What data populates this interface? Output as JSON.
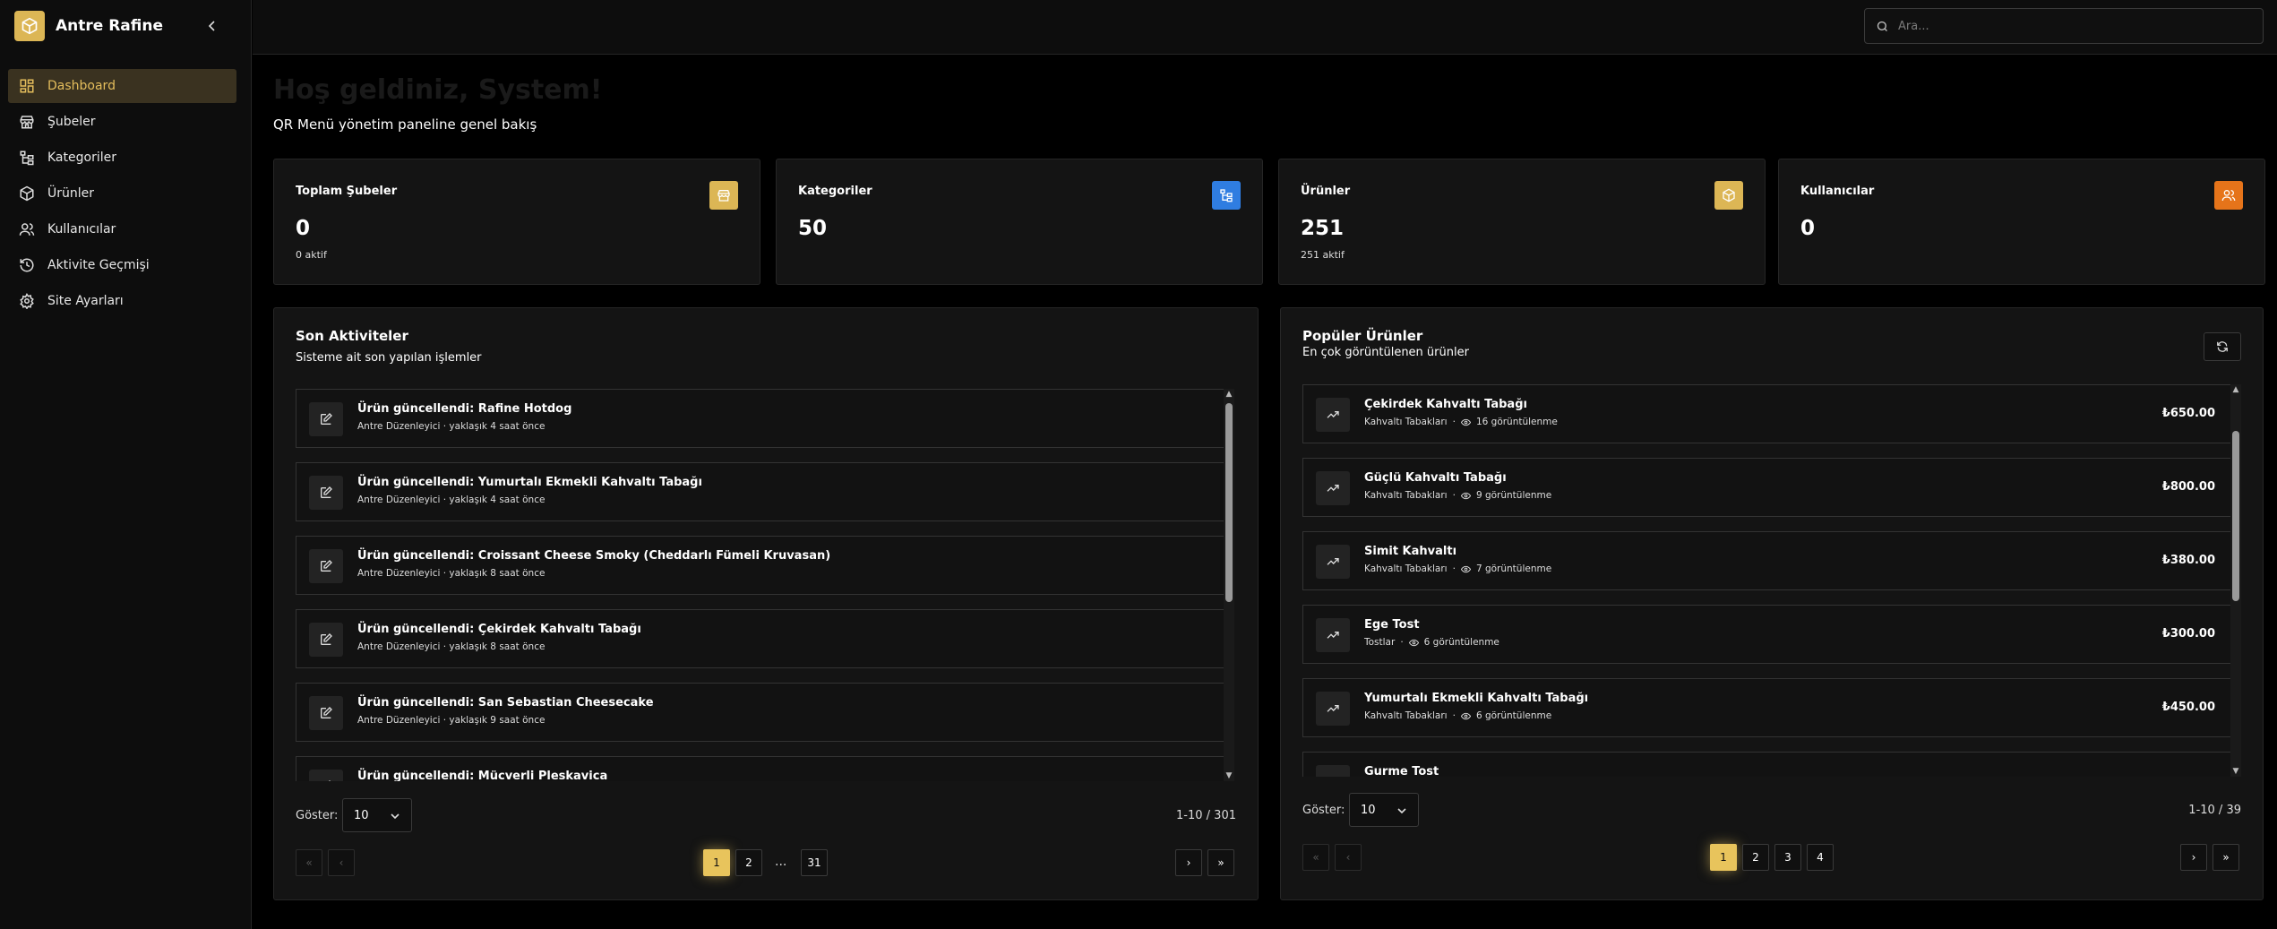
{
  "brand": {
    "name": "Antre Rafine"
  },
  "sidebar": {
    "items": [
      {
        "label": "Dashboard",
        "icon": "dashboard-icon",
        "active": true
      },
      {
        "label": "Şubeler",
        "icon": "store-icon"
      },
      {
        "label": "Kategoriler",
        "icon": "category-icon"
      },
      {
        "label": "Ürünler",
        "icon": "box-icon"
      },
      {
        "label": "Kullanıcılar",
        "icon": "users-icon"
      },
      {
        "label": "Aktivite Geçmişi",
        "icon": "history-icon"
      },
      {
        "label": "Site Ayarları",
        "icon": "gear-icon"
      }
    ]
  },
  "search": {
    "placeholder": "Ara..."
  },
  "welcome": {
    "title": "Hoş geldiniz, System!",
    "subtitle": "QR Menü yönetim paneline genel bakış"
  },
  "stats": [
    {
      "title": "Toplam Şubeler",
      "value": "0",
      "sub": "0 aktif",
      "color": "#dcb655",
      "icon": "store-icon"
    },
    {
      "title": "Kategoriler",
      "value": "50",
      "sub": "",
      "color": "#2f7de1",
      "icon": "category-icon"
    },
    {
      "title": "Ürünler",
      "value": "251",
      "sub": "251 aktif",
      "color": "#dcb655",
      "icon": "box-icon"
    },
    {
      "title": "Kullanıcılar",
      "value": "0",
      "sub": "",
      "color": "#e6741a",
      "icon": "users-icon"
    }
  ],
  "activities": {
    "title": "Son Aktiviteler",
    "subtitle": "Sisteme ait son yapılan işlemler",
    "items": [
      {
        "title": "Ürün güncellendi: Rafine Hotdog",
        "meta": "Antre Düzenleyici · yaklaşık 4 saat önce"
      },
      {
        "title": "Ürün güncellendi: Yumurtalı Ekmekli Kahvaltı Tabağı",
        "meta": "Antre Düzenleyici · yaklaşık 4 saat önce"
      },
      {
        "title": "Ürün güncellendi: Croissant Cheese Smoky (Cheddarlı Fümeli Kruvasan)",
        "meta": "Antre Düzenleyici · yaklaşık 8 saat önce"
      },
      {
        "title": "Ürün güncellendi: Çekirdek Kahvaltı Tabağı",
        "meta": "Antre Düzenleyici · yaklaşık 8 saat önce"
      },
      {
        "title": "Ürün güncellendi: San Sebastian Cheesecake",
        "meta": "Antre Düzenleyici · yaklaşık 9 saat önce"
      },
      {
        "title": "Ürün güncellendi: Mücverli Pleskavica",
        "meta": ""
      }
    ],
    "show_label": "Göster:",
    "page_size": "10",
    "range": "1-10 / 301",
    "pages": [
      "1",
      "2",
      "...",
      "31"
    ]
  },
  "popular": {
    "title": "Popüler Ürünler",
    "subtitle": "En çok görüntülenen ürünler",
    "items": [
      {
        "name": "Çekirdek Kahvaltı Tabağı",
        "category": "Kahvaltı Tabakları",
        "views": "16 görüntülenme",
        "price": "₺650.00"
      },
      {
        "name": "Güçlü Kahvaltı Tabağı",
        "category": "Kahvaltı Tabakları",
        "views": "9 görüntülenme",
        "price": "₺800.00"
      },
      {
        "name": "Simit Kahvaltı",
        "category": "Kahvaltı Tabakları",
        "views": "7 görüntülenme",
        "price": "₺380.00"
      },
      {
        "name": "Ege Tost",
        "category": "Tostlar",
        "views": "6 görüntülenme",
        "price": "₺300.00"
      },
      {
        "name": "Yumurtalı Ekmekli Kahvaltı Tabağı",
        "category": "Kahvaltı Tabakları",
        "views": "6 görüntülenme",
        "price": "₺450.00"
      },
      {
        "name": "Gurme Tost",
        "category": "",
        "views": "",
        "price": ""
      }
    ],
    "show_label": "Göster:",
    "page_size": "10",
    "range": "1-10 / 39",
    "pages": [
      "1",
      "2",
      "3",
      "4"
    ]
  }
}
